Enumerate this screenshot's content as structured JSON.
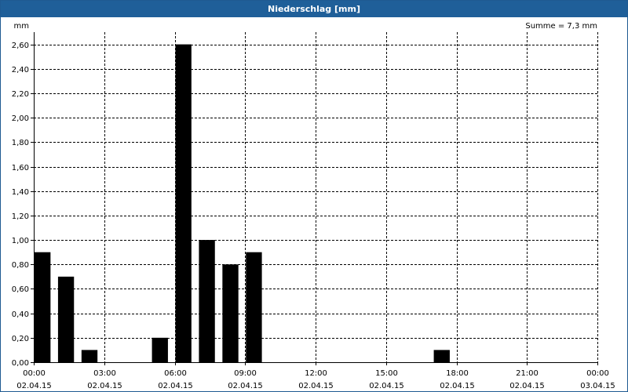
{
  "window": {
    "title": "Niederschlag [mm]"
  },
  "chart_data": {
    "type": "bar",
    "title": "Niederschlag [mm]",
    "ylabel": "mm",
    "ylim": [
      0,
      2.7
    ],
    "yticks": [
      0,
      0.2,
      0.4,
      0.6,
      0.8,
      1.0,
      1.2,
      1.4,
      1.6,
      1.8,
      2.0,
      2.2,
      2.4,
      2.6
    ],
    "ytick_labels": [
      "0,00",
      "0,20",
      "0,40",
      "0,60",
      "0,80",
      "1,00",
      "1,20",
      "1,40",
      "1,60",
      "1,80",
      "2,00",
      "2,20",
      "2,40",
      "2,60"
    ],
    "x_hours_range": [
      0,
      24
    ],
    "xticks": [
      {
        "hour": 0,
        "time": "00:00",
        "date": "02.04.15"
      },
      {
        "hour": 3,
        "time": "03:00",
        "date": "02.04.15"
      },
      {
        "hour": 6,
        "time": "06:00",
        "date": "02.04.15"
      },
      {
        "hour": 9,
        "time": "09:00",
        "date": "02.04.15"
      },
      {
        "hour": 12,
        "time": "12:00",
        "date": "02.04.15"
      },
      {
        "hour": 15,
        "time": "15:00",
        "date": "02.04.15"
      },
      {
        "hour": 18,
        "time": "18:00",
        "date": "02.04.15"
      },
      {
        "hour": 21,
        "time": "21:00",
        "date": "02.04.15"
      },
      {
        "hour": 24,
        "time": "00:00",
        "date": "03.04.15"
      }
    ],
    "bars": [
      {
        "hour": 0,
        "value": 0.9
      },
      {
        "hour": 1,
        "value": 0.7
      },
      {
        "hour": 2,
        "value": 0.1
      },
      {
        "hour": 5,
        "value": 0.2
      },
      {
        "hour": 6,
        "value": 2.6
      },
      {
        "hour": 7,
        "value": 1.0
      },
      {
        "hour": 8,
        "value": 0.8
      },
      {
        "hour": 9,
        "value": 0.9
      },
      {
        "hour": 17,
        "value": 0.1
      }
    ],
    "annotation": "Summe = 7,3 mm",
    "grid": true,
    "bar_color": "#000000"
  }
}
